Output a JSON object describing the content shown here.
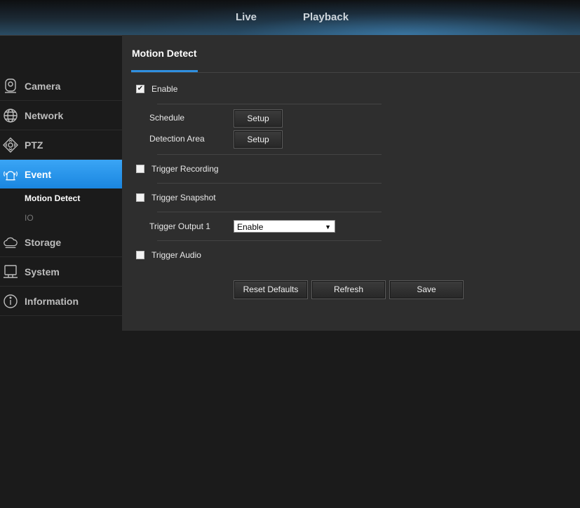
{
  "topnav": {
    "live": "Live",
    "playback": "Playback"
  },
  "sidebar": {
    "items": [
      {
        "label": "Camera",
        "icon": "camera-icon"
      },
      {
        "label": "Network",
        "icon": "globe-icon"
      },
      {
        "label": "PTZ",
        "icon": "ptz-icon"
      },
      {
        "label": "Event",
        "icon": "alarm-icon",
        "active": true
      },
      {
        "label": "Storage",
        "icon": "cloud-icon"
      },
      {
        "label": "System",
        "icon": "monitor-icon"
      },
      {
        "label": "Information",
        "icon": "info-icon"
      }
    ],
    "event_sub": [
      {
        "label": "Motion Detect",
        "selected": true
      },
      {
        "label": "IO",
        "selected": false
      }
    ]
  },
  "panel": {
    "title": "Motion Detect",
    "enable": {
      "label": "Enable",
      "checked": true
    },
    "schedule": {
      "label": "Schedule",
      "button": "Setup"
    },
    "detection_area": {
      "label": "Detection Area",
      "button": "Setup"
    },
    "trigger_recording": {
      "label": "Trigger Recording",
      "checked": false
    },
    "trigger_snapshot": {
      "label": "Trigger Snapshot",
      "checked": false
    },
    "trigger_output": {
      "label": "Trigger Output 1",
      "value": "Enable"
    },
    "trigger_audio": {
      "label": "Trigger Audio",
      "checked": false
    },
    "buttons": {
      "reset": "Reset Defaults",
      "refresh": "Refresh",
      "save": "Save"
    }
  },
  "colors": {
    "accent": "#2f8fe0",
    "panel_bg": "#2e2e2e",
    "page_bg": "#1b1b1b"
  }
}
